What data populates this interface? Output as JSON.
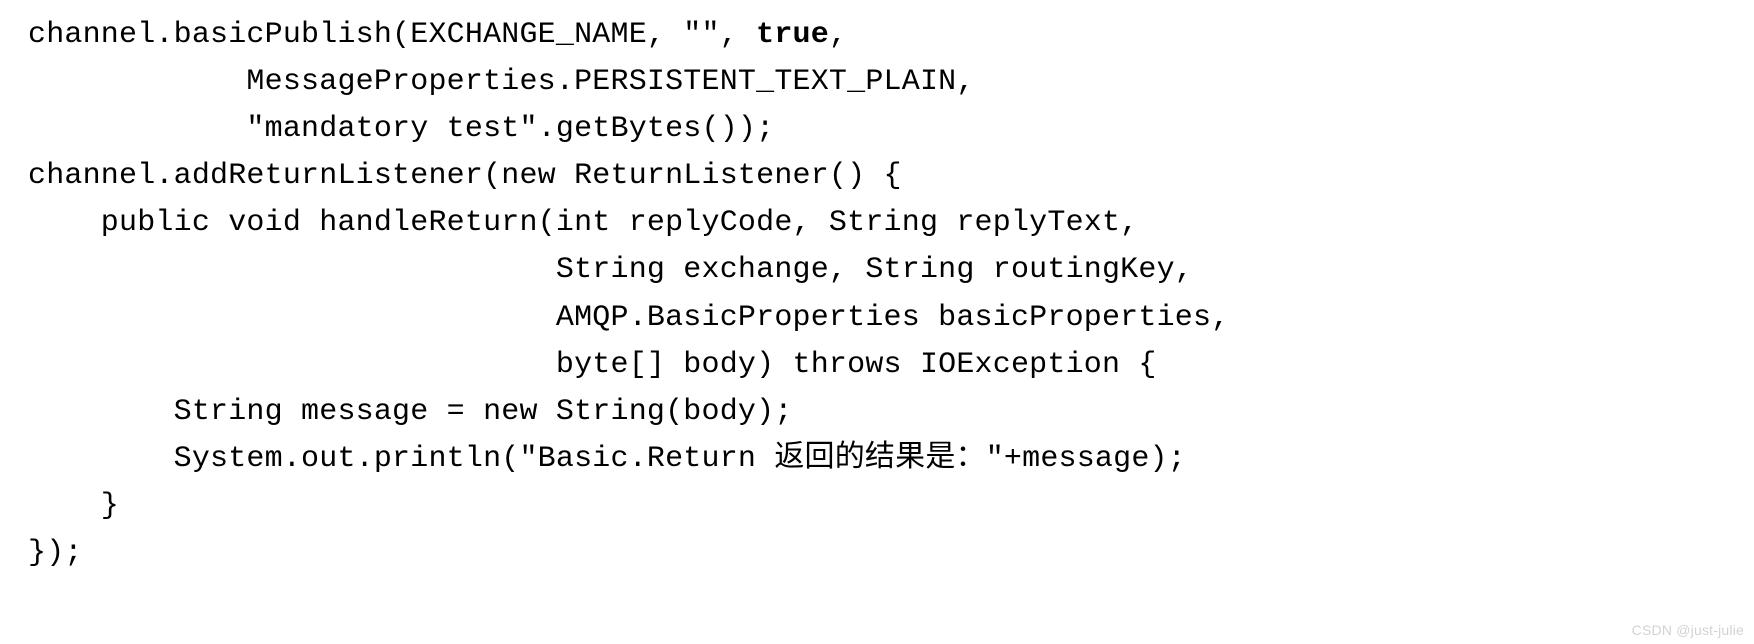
{
  "code": {
    "l1a": "channel.basicPublish(EXCHANGE_NAME, \"\", ",
    "l1b": "true",
    "l1c": ",",
    "l2": "            MessageProperties.PERSISTENT_TEXT_PLAIN,",
    "l3": "            \"mandatory test\".getBytes());",
    "l4": "channel.addReturnListener(new ReturnListener() {",
    "l5": "    public void handleReturn(int replyCode, String replyText,",
    "l6": "                             String exchange, String routingKey,",
    "l7": "                             AMQP.BasicProperties basicProperties,",
    "l8": "                             byte[] body) throws IOException {",
    "l9": "        String message = new String(body);",
    "l10": "        System.out.println(\"Basic.Return 返回的结果是：\"+message);",
    "l11": "    }",
    "l12": "});"
  },
  "watermark": "CSDN @just-julie"
}
